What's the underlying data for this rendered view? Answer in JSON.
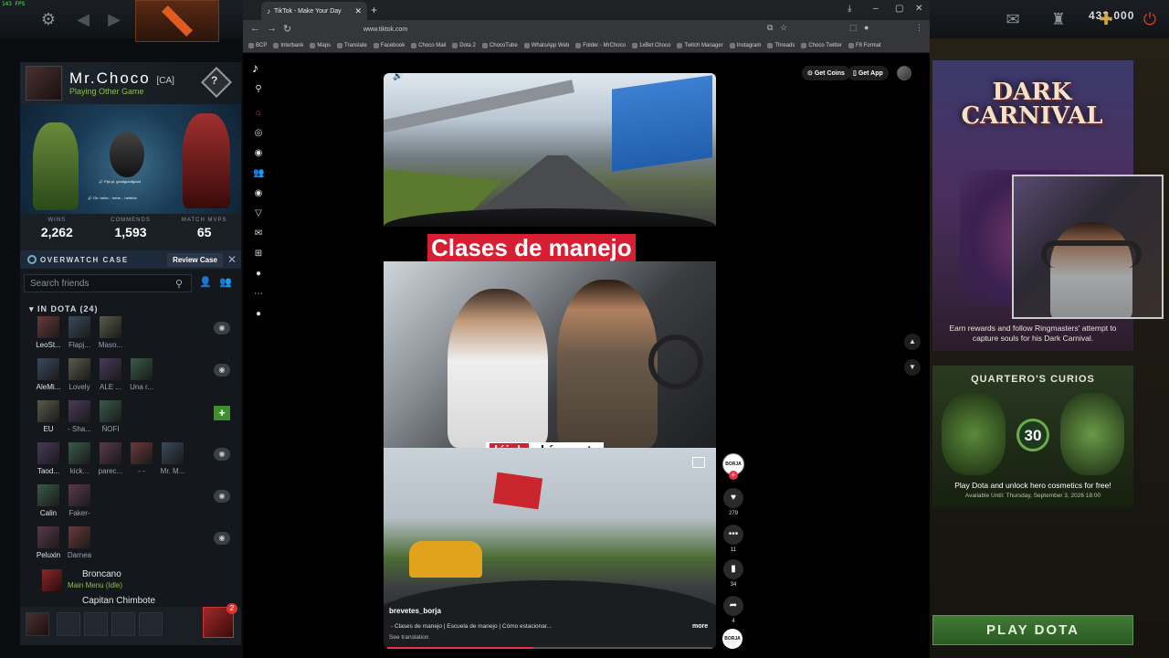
{
  "dota": {
    "fps": "143 FPS",
    "gold": "433,000",
    "profile": {
      "name": "Mr.Choco",
      "tag": "[CA]",
      "status": "Playing Other Game",
      "rank_icon": "?"
    },
    "showcase": {
      "voice1": "Pipi pi, goodgoodgood",
      "voice2": "Ge..hehe... hehe... hehehe"
    },
    "stats": [
      {
        "label": "WINS",
        "value": "2,262"
      },
      {
        "label": "COMMENDS",
        "value": "1,593"
      },
      {
        "label": "MATCH MVPS",
        "value": "65"
      }
    ],
    "overwatch": {
      "label": "OVERWATCH CASE",
      "button": "Review Case",
      "close": "✕"
    },
    "search_placeholder": "Search friends",
    "in_dota_header": "IN DOTA (24)",
    "friend_rows": [
      {
        "names": [
          "LeoSt...",
          "Flapj...",
          "Maso..."
        ],
        "action": "eye"
      },
      {
        "names": [
          "AleMi...",
          "Lovely",
          "ALE ...",
          "Una r..."
        ],
        "action": "eye"
      },
      {
        "names": [
          "EU",
          "- Sha...",
          "ÑOFI"
        ],
        "action": "plus"
      },
      {
        "names": [
          "Taod...",
          "kick...",
          "parec...",
          "- -",
          "Mr. M..."
        ],
        "action": "eye"
      },
      {
        "names": [
          "Calin",
          "Faker-"
        ],
        "action": "eye"
      },
      {
        "names": [
          "Peluxin",
          "Darnea"
        ],
        "action": "eye"
      }
    ],
    "broncano": {
      "name": "Broncano",
      "status": "Main Menu (Idle)",
      "next": "Capitan Chimbote"
    },
    "chat_badge": "2"
  },
  "browser": {
    "tab_title": "TikTok - Make Your Day",
    "url": "www.tiktok.com",
    "bookmarks": [
      "BCP",
      "Interbank",
      "Maps",
      "Translate",
      "Facebook",
      "Choco Mail",
      "Dota 2",
      "ChocoTube",
      "WhatsApp Web",
      "Folder - MrChoco",
      "1xBet Choco",
      "Twitch Manager",
      "Instagram",
      "Threads",
      "Choco Twitter",
      "F8 Format"
    ]
  },
  "tiktok": {
    "get_coins": "Get Coins",
    "get_app": "Get App",
    "video": {
      "title_overlay": "Clases de manejo",
      "subtitle_pre": "",
      "subtitle_hl": "déjalo",
      "subtitle_post": " ahí exacto",
      "username": "brevetes_borja",
      "description": "- Clases de manejo | Escuela de manejo | Cómo estacionar...",
      "more": "more",
      "see_translation": "See translation",
      "progress_pct": 45
    },
    "creator_label": "BORJA",
    "actions": [
      {
        "name": "like",
        "icon": "♥",
        "count": "279"
      },
      {
        "name": "comment",
        "icon": "•••",
        "count": "11"
      },
      {
        "name": "bookmark",
        "icon": "▮",
        "count": "34"
      },
      {
        "name": "share",
        "icon": "➦",
        "count": "4"
      }
    ]
  },
  "right_panel": {
    "carnival_title_1": "DARK",
    "carnival_title_2": "CARNIVAL",
    "carnival_desc": "Earn rewards and follow Ringmasters' attempt to capture souls for his Dark Carnival.",
    "curios_title": "QUARTERO'S CURIOS",
    "curios_badge": "30",
    "curios_desc": "Play Dota and unlock hero cosmetics for free!",
    "curios_date": "Available Until:  Thursday, September 3, 2026 18:00",
    "play_button": "PLAY DOTA"
  }
}
